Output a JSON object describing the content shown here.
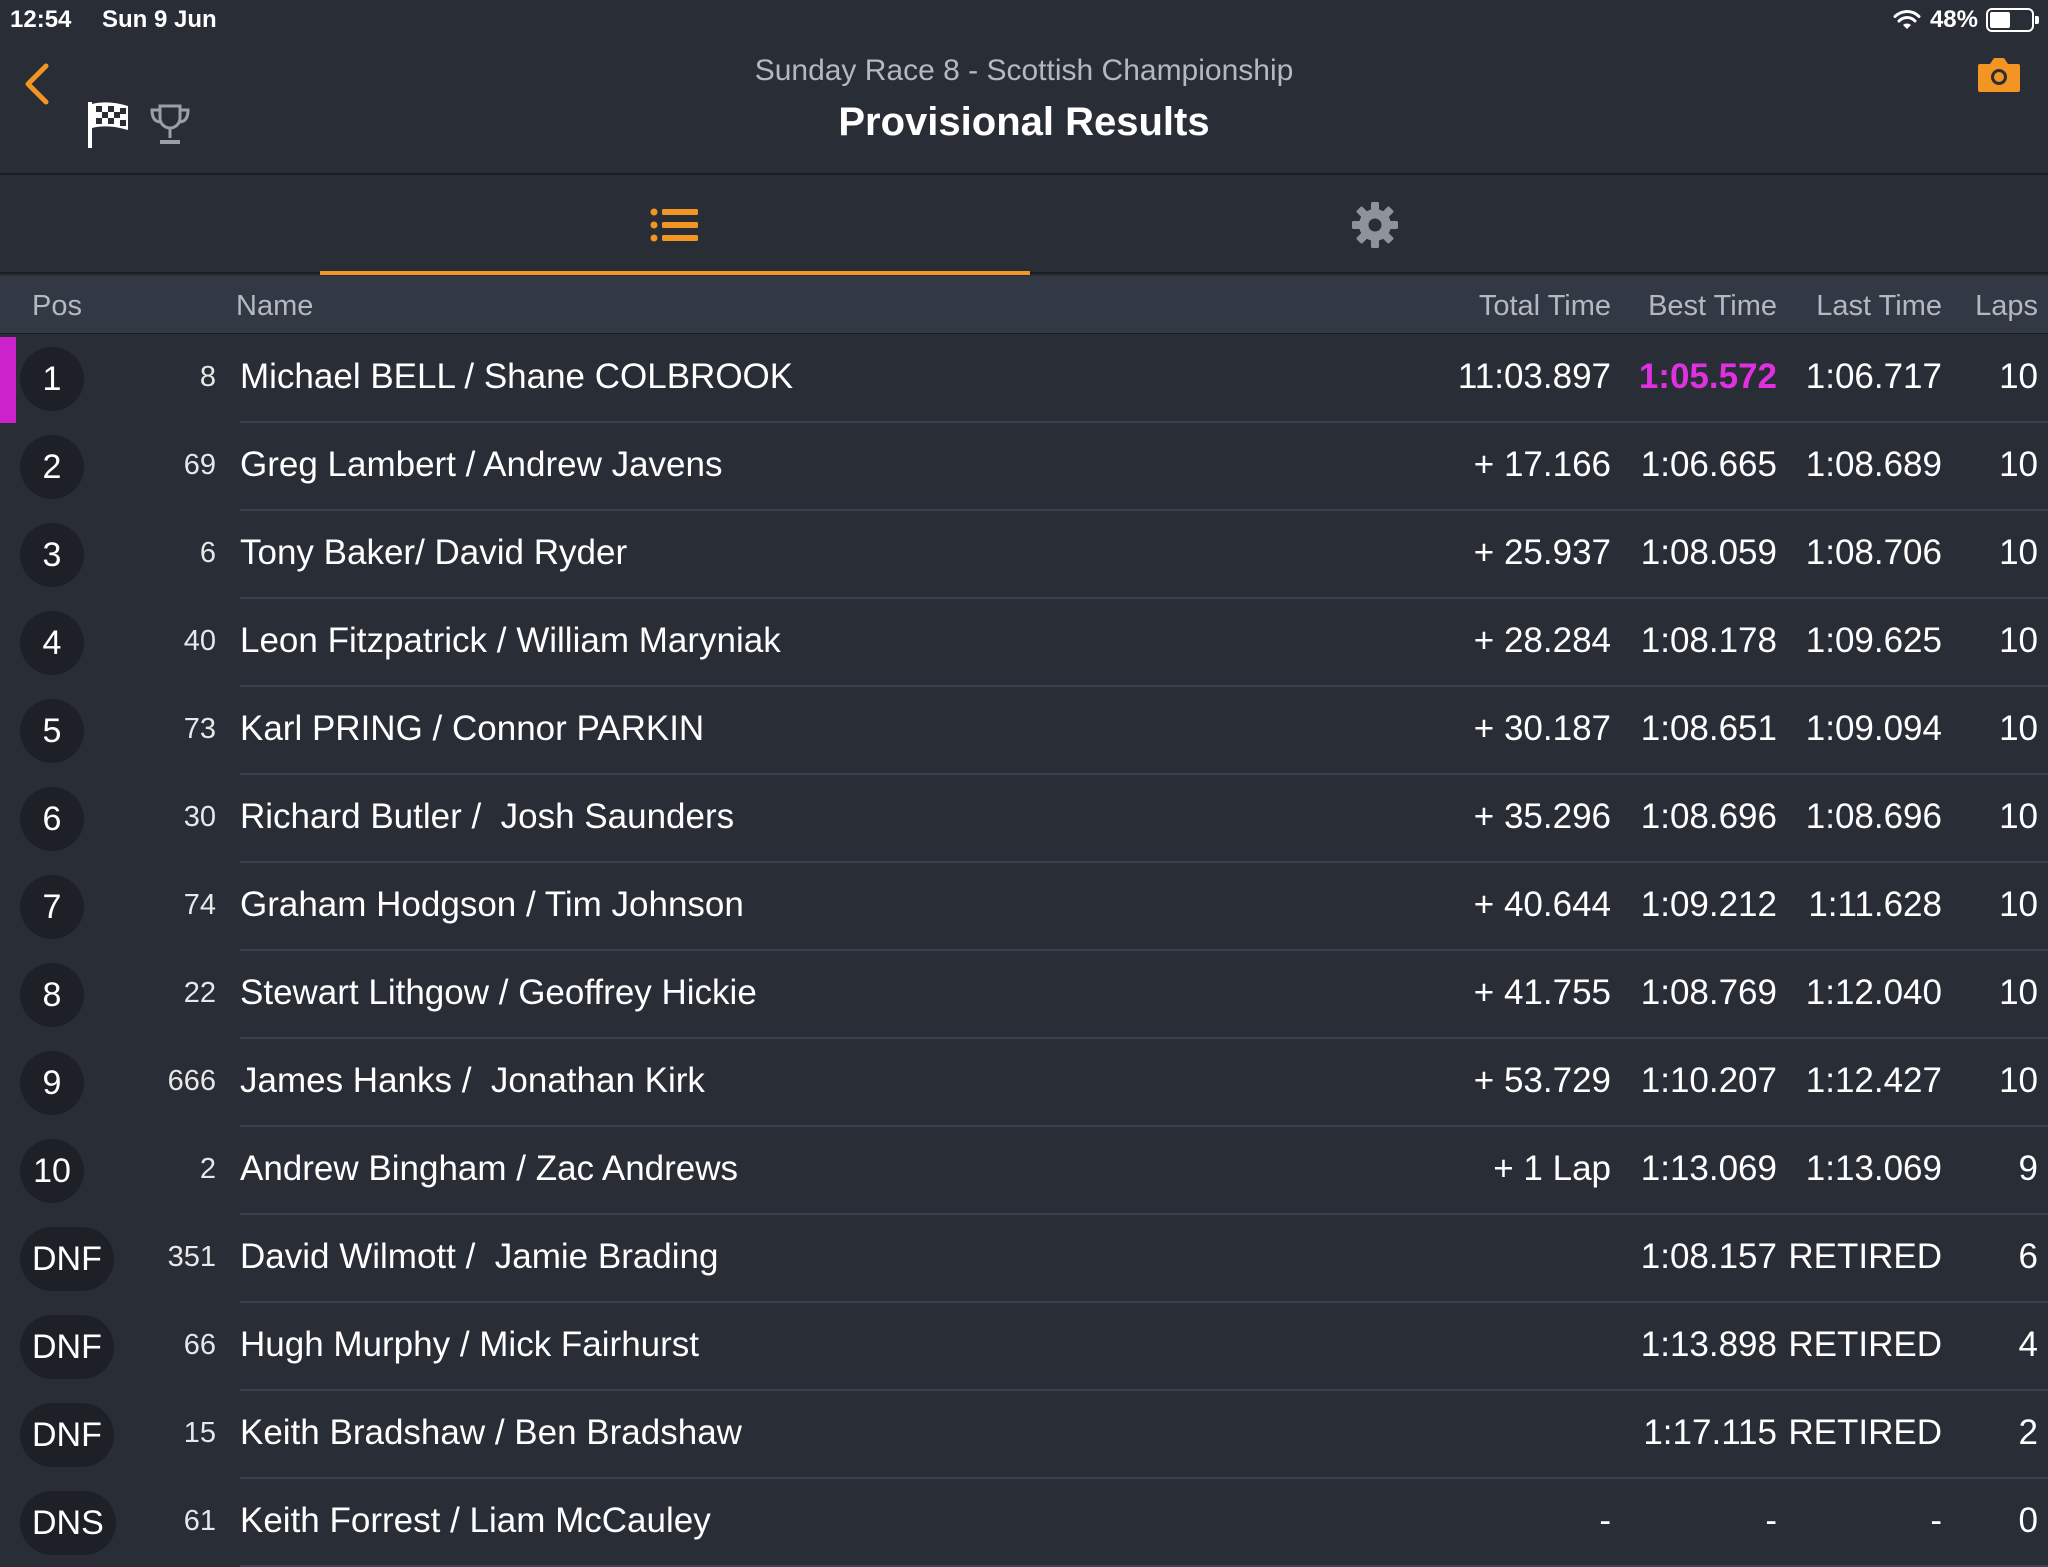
{
  "status_bar": {
    "time": "12:54",
    "date": "Sun 9 Jun",
    "battery": "48%"
  },
  "header": {
    "subtitle": "Sunday Race 8 - Scottish Championship",
    "title": "Provisional Results",
    "accent_color": "#f29523"
  },
  "columns": {
    "pos": "Pos",
    "name": "Name",
    "total_time": "Total Time",
    "best_time": "Best Time",
    "last_time": "Last Time",
    "laps": "Laps"
  },
  "rows": [
    {
      "pos": "1",
      "num": "8",
      "name": "Michael BELL / Shane COLBROOK",
      "total": "11:03.897",
      "best": "1:05.572",
      "last": "1:06.717",
      "laps": "10"
    },
    {
      "pos": "2",
      "num": "69",
      "name": "Greg Lambert / Andrew Javens",
      "total": "+ 17.166",
      "best": "1:06.665",
      "last": "1:08.689",
      "laps": "10"
    },
    {
      "pos": "3",
      "num": "6",
      "name": "Tony Baker/ David Ryder",
      "total": "+ 25.937",
      "best": "1:08.059",
      "last": "1:08.706",
      "laps": "10"
    },
    {
      "pos": "4",
      "num": "40",
      "name": "Leon Fitzpatrick / William Maryniak",
      "total": "+ 28.284",
      "best": "1:08.178",
      "last": "1:09.625",
      "laps": "10"
    },
    {
      "pos": "5",
      "num": "73",
      "name": "Karl PRING / Connor PARKIN",
      "total": "+ 30.187",
      "best": "1:08.651",
      "last": "1:09.094",
      "laps": "10"
    },
    {
      "pos": "6",
      "num": "30",
      "name": "Richard Butler /  Josh Saunders",
      "total": "+ 35.296",
      "best": "1:08.696",
      "last": "1:08.696",
      "laps": "10"
    },
    {
      "pos": "7",
      "num": "74",
      "name": "Graham Hodgson / Tim Johnson",
      "total": "+ 40.644",
      "best": "1:09.212",
      "last": "1:11.628",
      "laps": "10"
    },
    {
      "pos": "8",
      "num": "22",
      "name": "Stewart Lithgow / Geoffrey Hickie",
      "total": "+ 41.755",
      "best": "1:08.769",
      "last": "1:12.040",
      "laps": "10"
    },
    {
      "pos": "9",
      "num": "666",
      "name": "James Hanks /  Jonathan Kirk",
      "total": "+ 53.729",
      "best": "1:10.207",
      "last": "1:12.427",
      "laps": "10"
    },
    {
      "pos": "10",
      "num": "2",
      "name": "Andrew Bingham / Zac Andrews",
      "total": "+ 1 Lap",
      "best": "1:13.069",
      "last": "1:13.069",
      "laps": "9"
    },
    {
      "pos": "DNF",
      "num": "351",
      "name": "David Wilmott /  Jamie Brading",
      "total": "",
      "best": "1:08.157",
      "last": "RETIRED",
      "laps": "6"
    },
    {
      "pos": "DNF",
      "num": "66",
      "name": "Hugh Murphy / Mick Fairhurst",
      "total": "",
      "best": "1:13.898",
      "last": "RETIRED",
      "laps": "4"
    },
    {
      "pos": "DNF",
      "num": "15",
      "name": "Keith Bradshaw / Ben Bradshaw",
      "total": "",
      "best": "1:17.115",
      "last": "RETIRED",
      "laps": "2"
    },
    {
      "pos": "DNS",
      "num": "61",
      "name": "Keith Forrest / Liam McCauley",
      "total": "-",
      "best": "-",
      "last": "-",
      "laps": "0"
    }
  ],
  "highlight_color": "#e030e0"
}
